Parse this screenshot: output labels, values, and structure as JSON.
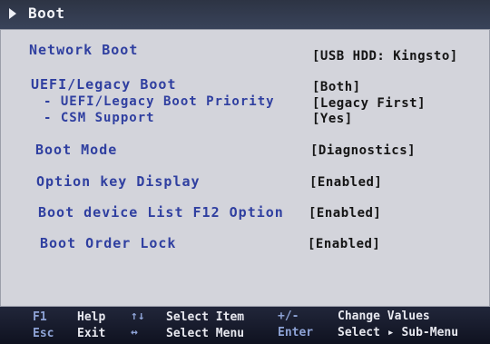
{
  "header": {
    "title": "Boot"
  },
  "settings": [
    {
      "label": "Network Boot",
      "value": "[USB HDD: Kingsto]"
    },
    {
      "label": "UEFI/Legacy Boot",
      "value": "[Both]"
    },
    {
      "label": "- UEFI/Legacy Boot Priority",
      "value": "[Legacy First]"
    },
    {
      "label": "- CSM Support",
      "value": "[Yes]"
    },
    {
      "label": "Boot Mode",
      "value": "[Diagnostics]"
    },
    {
      "label": "Option key Display",
      "value": "[Enabled]"
    },
    {
      "label": "Boot device List F12 Option",
      "value": "[Enabled]"
    },
    {
      "label": "Boot Order Lock",
      "value": "[Enabled]"
    }
  ],
  "help": {
    "f1": {
      "key": "F1",
      "desc": "Help"
    },
    "esc": {
      "key": "Esc",
      "desc": "Exit"
    },
    "updown": {
      "key": "↑↓",
      "desc": "Select Item"
    },
    "leftright": {
      "key": "↔",
      "desc": "Select Menu"
    },
    "plusminus": {
      "key": "+/-",
      "desc": "Change Values"
    },
    "enter": {
      "key": "Enter",
      "desc": "Select ▸ Sub-Menu"
    }
  }
}
